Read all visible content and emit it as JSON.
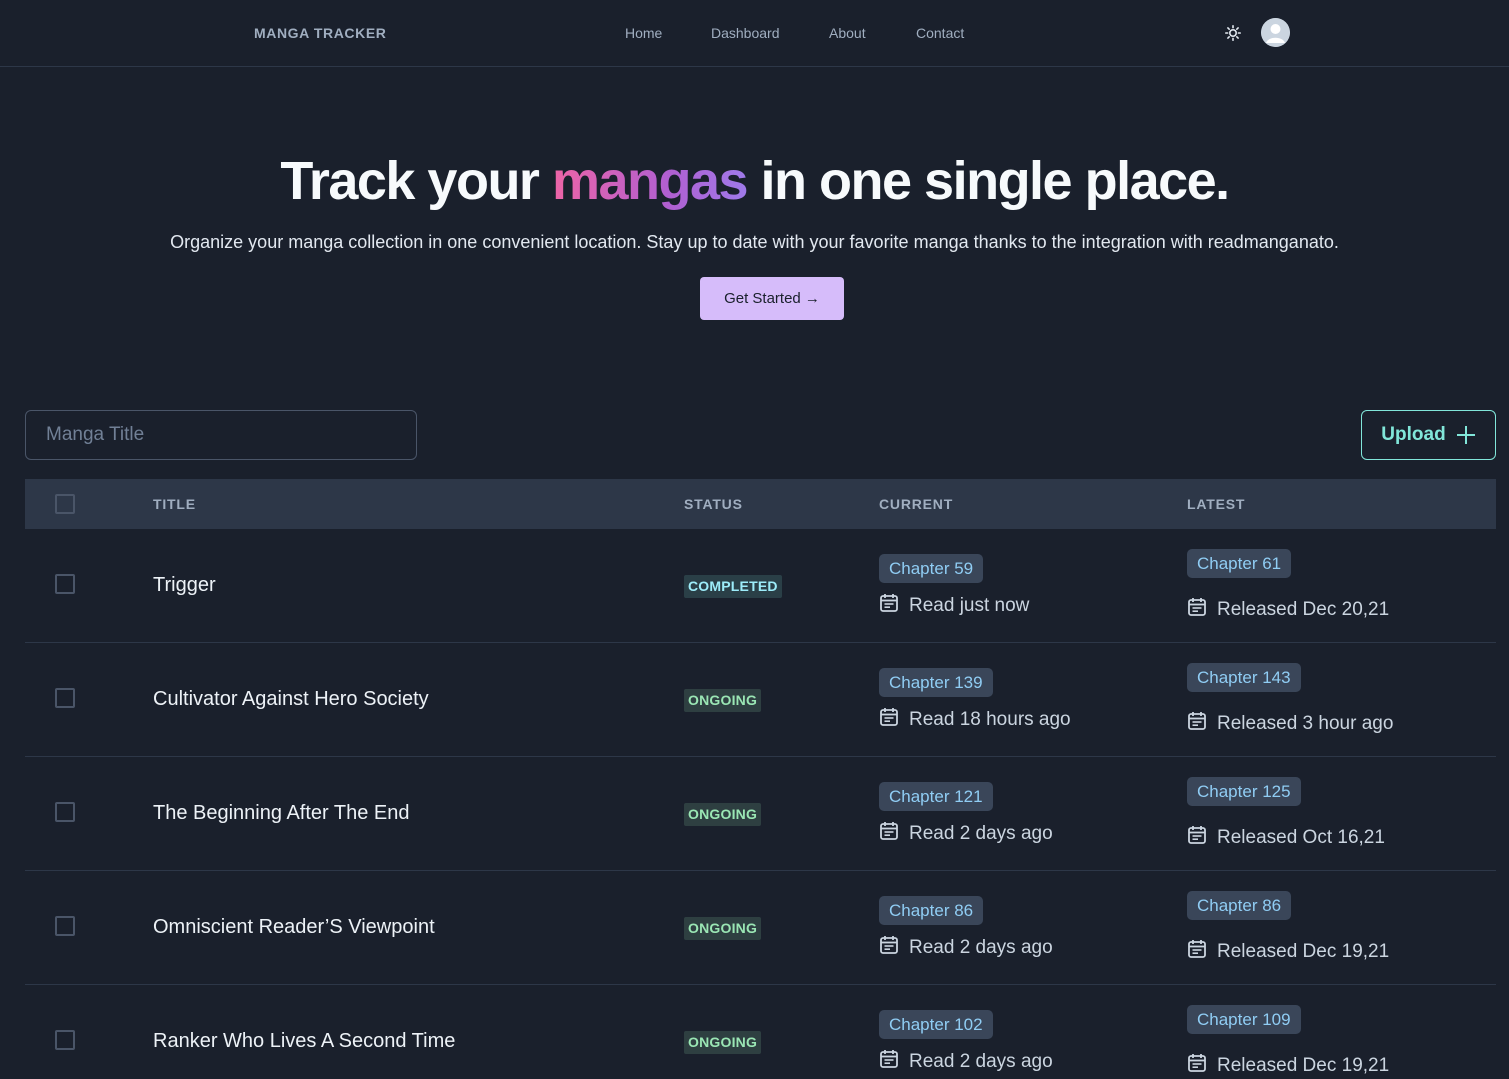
{
  "nav": {
    "brand": "MANGA TRACKER",
    "links": [
      "Home",
      "Dashboard",
      "About",
      "Contact"
    ],
    "theme_icon": "sun-icon",
    "avatar_icon": "user-avatar-icon"
  },
  "hero": {
    "title_before": "Track your ",
    "title_accent": "mangas",
    "title_after": " in one single place.",
    "subtitle": "Organize your manga collection in one convenient location. Stay up to date with your favorite manga thanks to the integration with readmanganato.",
    "cta_label": "Get Started →"
  },
  "toolbar": {
    "search_placeholder": "Manga Title",
    "upload_label": "Upload",
    "upload_icon": "plus-icon"
  },
  "table": {
    "headers": [
      "TITLE",
      "STATUS",
      "CURRENT",
      "LATEST"
    ],
    "rows": [
      {
        "title": "Trigger",
        "status": "COMPLETED",
        "current_chapter": "Chapter 59",
        "current_date": "Read just now",
        "latest_chapter": "Chapter 61",
        "latest_date": "Released Dec 20,21"
      },
      {
        "title": "Cultivator Against Hero Society",
        "status": "ONGOING",
        "current_chapter": "Chapter 139",
        "current_date": "Read 18 hours ago",
        "latest_chapter": "Chapter 143",
        "latest_date": "Released 3 hour ago"
      },
      {
        "title": "The Beginning After The End",
        "status": "ONGOING",
        "current_chapter": "Chapter 121",
        "current_date": "Read 2 days ago",
        "latest_chapter": "Chapter 125",
        "latest_date": "Released Oct 16,21"
      },
      {
        "title": "Omniscient Reader’S Viewpoint",
        "status": "ONGOING",
        "current_chapter": "Chapter 86",
        "current_date": "Read 2 days ago",
        "latest_chapter": "Chapter 86",
        "latest_date": "Released Dec 19,21"
      },
      {
        "title": "Ranker Who Lives A Second Time",
        "status": "ONGOING",
        "current_chapter": "Chapter 102",
        "current_date": "Read 2 days ago",
        "latest_chapter": "Chapter 109",
        "latest_date": "Released Dec 19,21"
      }
    ]
  },
  "colors": {
    "background": "#1a202c",
    "accent_purple": "#d6bcfa",
    "accent_teal": "#81e6d9",
    "chapter_blue": "#90cdf4",
    "status_green": "#9ae6b4"
  }
}
